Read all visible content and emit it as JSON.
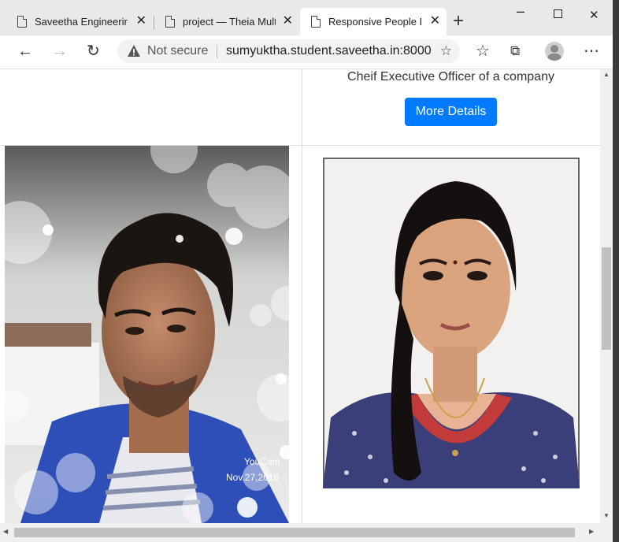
{
  "tabs": [
    {
      "title": "Saveetha Engineering College"
    },
    {
      "title": "project — Theia Multi-Language"
    },
    {
      "title": "Responsive People Details"
    }
  ],
  "toolbar": {
    "not_secure": "Not secure",
    "url": "sumyuktha.student.saveetha.in:8000"
  },
  "content": {
    "role_text": "Cheif Executive Officer of a company",
    "more_details": "More Details",
    "photo1_watermark": "YouCam",
    "photo1_date": "Nov.27,2016"
  }
}
